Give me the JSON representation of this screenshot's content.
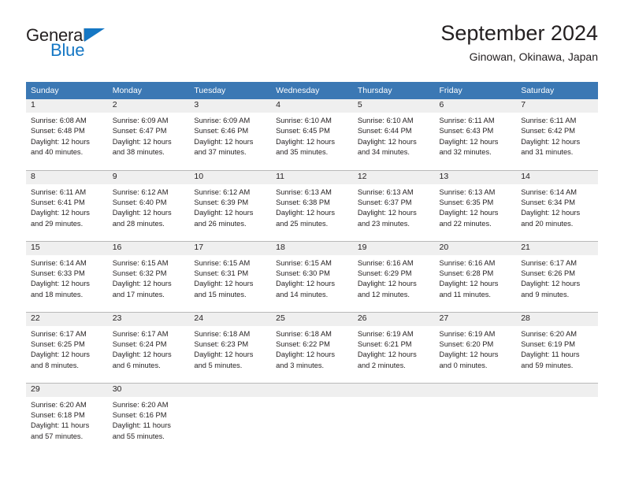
{
  "brand": {
    "name_part1": "General",
    "name_part2": "Blue",
    "triangle_icon": "triangle-icon",
    "color_dark": "#231f20",
    "color_blue": "#1577c4"
  },
  "header": {
    "title": "September 2024",
    "subtitle": "Ginowan, Okinawa, Japan"
  },
  "theme": {
    "header_blue": "#3b78b4",
    "day_band_gray": "#efefef",
    "row_divider": "#b9b9b9",
    "text": "#231f20"
  },
  "calendar": {
    "weekday_headers": [
      "Sunday",
      "Monday",
      "Tuesday",
      "Wednesday",
      "Thursday",
      "Friday",
      "Saturday"
    ],
    "weeks": [
      [
        {
          "day": "1",
          "sunrise": "Sunrise: 6:08 AM",
          "sunset": "Sunset: 6:48 PM",
          "daylight_line1": "Daylight: 12 hours",
          "daylight_line2": "and 40 minutes."
        },
        {
          "day": "2",
          "sunrise": "Sunrise: 6:09 AM",
          "sunset": "Sunset: 6:47 PM",
          "daylight_line1": "Daylight: 12 hours",
          "daylight_line2": "and 38 minutes."
        },
        {
          "day": "3",
          "sunrise": "Sunrise: 6:09 AM",
          "sunset": "Sunset: 6:46 PM",
          "daylight_line1": "Daylight: 12 hours",
          "daylight_line2": "and 37 minutes."
        },
        {
          "day": "4",
          "sunrise": "Sunrise: 6:10 AM",
          "sunset": "Sunset: 6:45 PM",
          "daylight_line1": "Daylight: 12 hours",
          "daylight_line2": "and 35 minutes."
        },
        {
          "day": "5",
          "sunrise": "Sunrise: 6:10 AM",
          "sunset": "Sunset: 6:44 PM",
          "daylight_line1": "Daylight: 12 hours",
          "daylight_line2": "and 34 minutes."
        },
        {
          "day": "6",
          "sunrise": "Sunrise: 6:11 AM",
          "sunset": "Sunset: 6:43 PM",
          "daylight_line1": "Daylight: 12 hours",
          "daylight_line2": "and 32 minutes."
        },
        {
          "day": "7",
          "sunrise": "Sunrise: 6:11 AM",
          "sunset": "Sunset: 6:42 PM",
          "daylight_line1": "Daylight: 12 hours",
          "daylight_line2": "and 31 minutes."
        }
      ],
      [
        {
          "day": "8",
          "sunrise": "Sunrise: 6:11 AM",
          "sunset": "Sunset: 6:41 PM",
          "daylight_line1": "Daylight: 12 hours",
          "daylight_line2": "and 29 minutes."
        },
        {
          "day": "9",
          "sunrise": "Sunrise: 6:12 AM",
          "sunset": "Sunset: 6:40 PM",
          "daylight_line1": "Daylight: 12 hours",
          "daylight_line2": "and 28 minutes."
        },
        {
          "day": "10",
          "sunrise": "Sunrise: 6:12 AM",
          "sunset": "Sunset: 6:39 PM",
          "daylight_line1": "Daylight: 12 hours",
          "daylight_line2": "and 26 minutes."
        },
        {
          "day": "11",
          "sunrise": "Sunrise: 6:13 AM",
          "sunset": "Sunset: 6:38 PM",
          "daylight_line1": "Daylight: 12 hours",
          "daylight_line2": "and 25 minutes."
        },
        {
          "day": "12",
          "sunrise": "Sunrise: 6:13 AM",
          "sunset": "Sunset: 6:37 PM",
          "daylight_line1": "Daylight: 12 hours",
          "daylight_line2": "and 23 minutes."
        },
        {
          "day": "13",
          "sunrise": "Sunrise: 6:13 AM",
          "sunset": "Sunset: 6:35 PM",
          "daylight_line1": "Daylight: 12 hours",
          "daylight_line2": "and 22 minutes."
        },
        {
          "day": "14",
          "sunrise": "Sunrise: 6:14 AM",
          "sunset": "Sunset: 6:34 PM",
          "daylight_line1": "Daylight: 12 hours",
          "daylight_line2": "and 20 minutes."
        }
      ],
      [
        {
          "day": "15",
          "sunrise": "Sunrise: 6:14 AM",
          "sunset": "Sunset: 6:33 PM",
          "daylight_line1": "Daylight: 12 hours",
          "daylight_line2": "and 18 minutes."
        },
        {
          "day": "16",
          "sunrise": "Sunrise: 6:15 AM",
          "sunset": "Sunset: 6:32 PM",
          "daylight_line1": "Daylight: 12 hours",
          "daylight_line2": "and 17 minutes."
        },
        {
          "day": "17",
          "sunrise": "Sunrise: 6:15 AM",
          "sunset": "Sunset: 6:31 PM",
          "daylight_line1": "Daylight: 12 hours",
          "daylight_line2": "and 15 minutes."
        },
        {
          "day": "18",
          "sunrise": "Sunrise: 6:15 AM",
          "sunset": "Sunset: 6:30 PM",
          "daylight_line1": "Daylight: 12 hours",
          "daylight_line2": "and 14 minutes."
        },
        {
          "day": "19",
          "sunrise": "Sunrise: 6:16 AM",
          "sunset": "Sunset: 6:29 PM",
          "daylight_line1": "Daylight: 12 hours",
          "daylight_line2": "and 12 minutes."
        },
        {
          "day": "20",
          "sunrise": "Sunrise: 6:16 AM",
          "sunset": "Sunset: 6:28 PM",
          "daylight_line1": "Daylight: 12 hours",
          "daylight_line2": "and 11 minutes."
        },
        {
          "day": "21",
          "sunrise": "Sunrise: 6:17 AM",
          "sunset": "Sunset: 6:26 PM",
          "daylight_line1": "Daylight: 12 hours",
          "daylight_line2": "and 9 minutes."
        }
      ],
      [
        {
          "day": "22",
          "sunrise": "Sunrise: 6:17 AM",
          "sunset": "Sunset: 6:25 PM",
          "daylight_line1": "Daylight: 12 hours",
          "daylight_line2": "and 8 minutes."
        },
        {
          "day": "23",
          "sunrise": "Sunrise: 6:17 AM",
          "sunset": "Sunset: 6:24 PM",
          "daylight_line1": "Daylight: 12 hours",
          "daylight_line2": "and 6 minutes."
        },
        {
          "day": "24",
          "sunrise": "Sunrise: 6:18 AM",
          "sunset": "Sunset: 6:23 PM",
          "daylight_line1": "Daylight: 12 hours",
          "daylight_line2": "and 5 minutes."
        },
        {
          "day": "25",
          "sunrise": "Sunrise: 6:18 AM",
          "sunset": "Sunset: 6:22 PM",
          "daylight_line1": "Daylight: 12 hours",
          "daylight_line2": "and 3 minutes."
        },
        {
          "day": "26",
          "sunrise": "Sunrise: 6:19 AM",
          "sunset": "Sunset: 6:21 PM",
          "daylight_line1": "Daylight: 12 hours",
          "daylight_line2": "and 2 minutes."
        },
        {
          "day": "27",
          "sunrise": "Sunrise: 6:19 AM",
          "sunset": "Sunset: 6:20 PM",
          "daylight_line1": "Daylight: 12 hours",
          "daylight_line2": "and 0 minutes."
        },
        {
          "day": "28",
          "sunrise": "Sunrise: 6:20 AM",
          "sunset": "Sunset: 6:19 PM",
          "daylight_line1": "Daylight: 11 hours",
          "daylight_line2": "and 59 minutes."
        }
      ],
      [
        {
          "day": "29",
          "sunrise": "Sunrise: 6:20 AM",
          "sunset": "Sunset: 6:18 PM",
          "daylight_line1": "Daylight: 11 hours",
          "daylight_line2": "and 57 minutes."
        },
        {
          "day": "30",
          "sunrise": "Sunrise: 6:20 AM",
          "sunset": "Sunset: 6:16 PM",
          "daylight_line1": "Daylight: 11 hours",
          "daylight_line2": "and 55 minutes."
        },
        {
          "day": "",
          "sunrise": "",
          "sunset": "",
          "daylight_line1": "",
          "daylight_line2": ""
        },
        {
          "day": "",
          "sunrise": "",
          "sunset": "",
          "daylight_line1": "",
          "daylight_line2": ""
        },
        {
          "day": "",
          "sunrise": "",
          "sunset": "",
          "daylight_line1": "",
          "daylight_line2": ""
        },
        {
          "day": "",
          "sunrise": "",
          "sunset": "",
          "daylight_line1": "",
          "daylight_line2": ""
        },
        {
          "day": "",
          "sunrise": "",
          "sunset": "",
          "daylight_line1": "",
          "daylight_line2": ""
        }
      ]
    ]
  }
}
